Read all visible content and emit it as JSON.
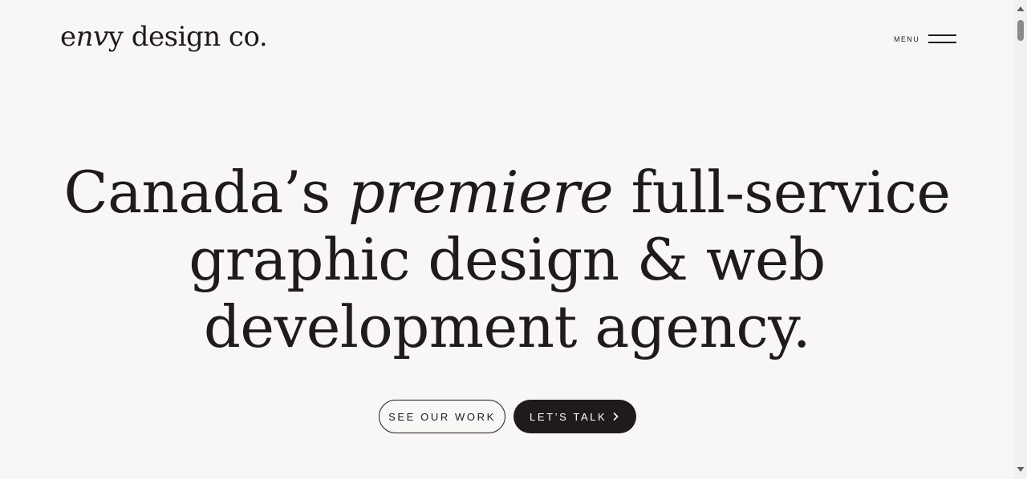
{
  "header": {
    "logo_part1": "e",
    "logo_part2": "nv",
    "logo_part3": "y design co.",
    "menu_label": "MENU"
  },
  "hero": {
    "line1_a": "Canada’s ",
    "line1_b": "premiere",
    "line1_c": " full-service",
    "line2": "graphic design & web",
    "line3": "development agency."
  },
  "cta": {
    "see_work_label": "SEE OUR WORK",
    "talk_label": "LET’S TALK",
    "talk_icon": "chevron-right-icon"
  },
  "scrollbar": {
    "up_icon": "arrow-up-icon",
    "down_icon": "arrow-down-icon"
  },
  "colors": {
    "background": "#f8f7f5",
    "text": "#1f1b1b",
    "button_dark": "#1f1b1b",
    "button_text_light": "#ffffff"
  }
}
